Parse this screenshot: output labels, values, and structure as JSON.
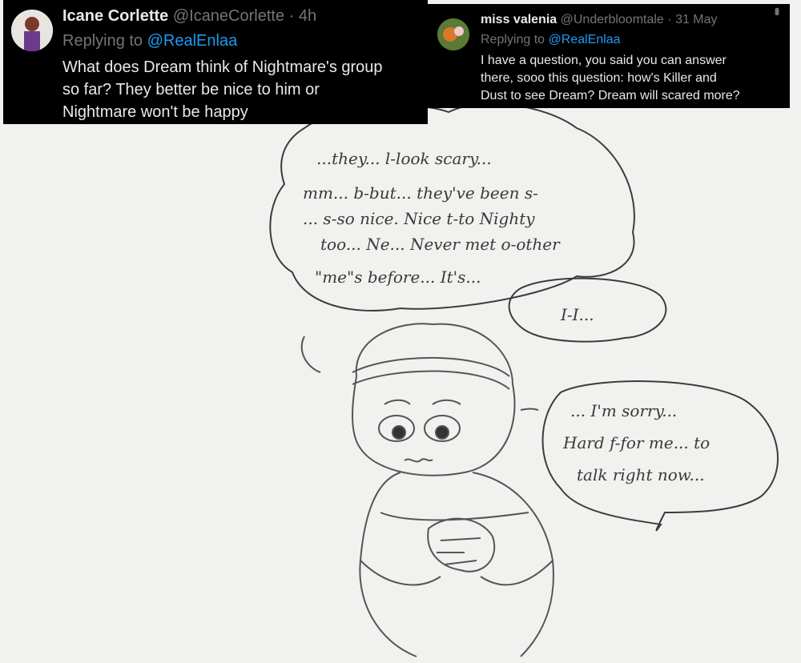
{
  "tweets": [
    {
      "name": "Icane Corlette",
      "handle": "@IcaneCorlette",
      "separator": "·",
      "time": "4h",
      "replying_prefix": "Replying to",
      "replying_to": "@RealEnlaa",
      "lines": [
        "What does Dream think of Nightmare's group",
        "so far? They better be nice to him or",
        "Nightmare won't be happy"
      ]
    },
    {
      "name": "miss valenia",
      "handle": "@Underbloomtale",
      "separator": "·",
      "time": "31 May",
      "replying_prefix": "Replying to",
      "replying_to": "@RealEnlaa",
      "lines": [
        "I have a question, you said you can answer",
        "there, sooo this question: how's Killer and",
        "Dust to see Dream? Dream will scared more?"
      ]
    }
  ],
  "drawing": {
    "bubble_main": [
      "...they... l-look scary...",
      "mm... b-but... they've been s-",
      "... s-so nice. Nice t-to Nighty",
      "too... Ne... Never met o-other",
      "\"me\"s before... It's..."
    ],
    "bubble_small": "I-I...",
    "bubble_right": [
      "... I'm sorry...",
      "Hard f-for me... to",
      "talk right now..."
    ]
  }
}
